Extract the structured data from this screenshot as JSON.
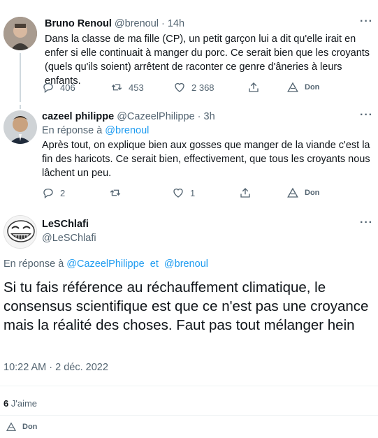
{
  "tweets": [
    {
      "name": "Bruno Renoul",
      "handle": "@brenoul",
      "time": "· 14h",
      "text": "Dans la classe de ma fille (CP), un petit garçon lui a dit qu'elle irait en enfer si elle continuait à manger du porc. Ce serait bien que les croyants (quels qu'ils soient) arrêtent de raconter ce genre d'âneries à leurs enfants.",
      "replies": "406",
      "retweets": "453",
      "likes": "2 368",
      "don_label": "Don",
      "more": "···"
    },
    {
      "name": "cazeel philippe",
      "handle": "@CazeelPhilippe",
      "time": "· 3h",
      "reply_prefix": "En réponse à",
      "reply_handle": "@brenoul",
      "text": "Après tout, on explique bien aux gosses que manger de la viande c'est la fin des haricots. Ce serait bien, effectivement, que tous les croyants nous lâchent un peu.",
      "replies": "2",
      "retweets": "",
      "likes": "1",
      "don_label": "Don",
      "more": "···"
    }
  ],
  "main": {
    "name": "LeSChlafi",
    "handle": "@LeSChlafi",
    "more": "···",
    "reply_prefix": "En réponse à",
    "reply_handle_1": "@CazeelPhilippe",
    "reply_and": "et",
    "reply_handle_2": "@brenoul",
    "text": "Si tu fais référence au réchauffement climatique, le consensus scientifique est que ce n'est pas une croyance mais la réalité des choses. Faut pas tout mélanger hein",
    "timestamp": "10:22 AM · 2 déc. 2022",
    "like_count": "6",
    "like_label": "J'aime",
    "don_label": "Don"
  },
  "colors": {
    "accent": "#1d9bf0",
    "secondary_text": "#536471",
    "primary_text": "#0f1419",
    "divider": "#eff3f4"
  }
}
